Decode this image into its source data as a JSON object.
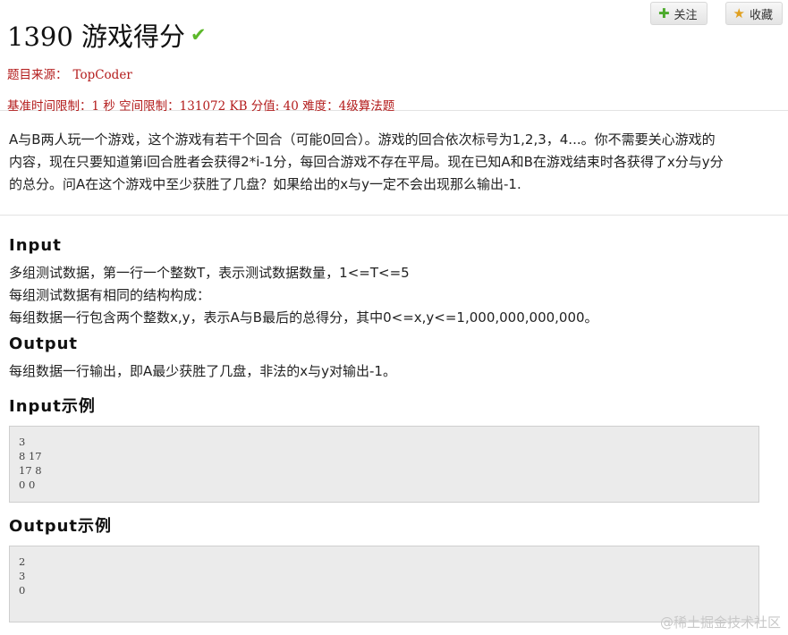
{
  "buttons": {
    "follow": "关注",
    "favorite": "收藏"
  },
  "problem": {
    "title": "1390 游戏得分",
    "source_label": "题目来源：",
    "source_value": "TopCoder",
    "limits": "基准时间限制：1 秒 空间限制：131072 KB 分值: 40 难度：4级算法题"
  },
  "description": [
    "A与B两人玩一个游戏，这个游戏有若干个回合（可能0回合）。游戏的回合依次标号为1,2,3，4...。你不需要关心游戏的",
    "内容，现在只要知道第i回合胜者会获得2*i-1分，每回合游戏不存在平局。现在已知A和B在游戏结束时各获得了x分与y分",
    "的总分。问A在这个游戏中至少获胜了几盘？如果给出的x与y一定不会出现那么输出-1."
  ],
  "input_section": {
    "title": "Input",
    "lines": [
      "多组测试数据，第一行一个整数T，表示测试数据数量，1<=T<=5",
      "每组测试数据有相同的结构构成：",
      "每组数据一行包含两个整数x,y，表示A与B最后的总得分，其中0<=x,y<=1,000,000,000,000。"
    ]
  },
  "output_section": {
    "title": "Output",
    "lines": [
      "每组数据一行输出，即A最少获胜了几盘，非法的x与y对输出-1。"
    ]
  },
  "input_example": {
    "title": "Input示例",
    "content": "3\n8 17\n17 8\n0 0"
  },
  "output_example": {
    "title": "Output示例",
    "content": "2\n3\n0"
  },
  "watermark": "@稀土掘金技术社区",
  "colors": {
    "accent_red": "#b31b1b",
    "check_green": "#5cb82a"
  }
}
